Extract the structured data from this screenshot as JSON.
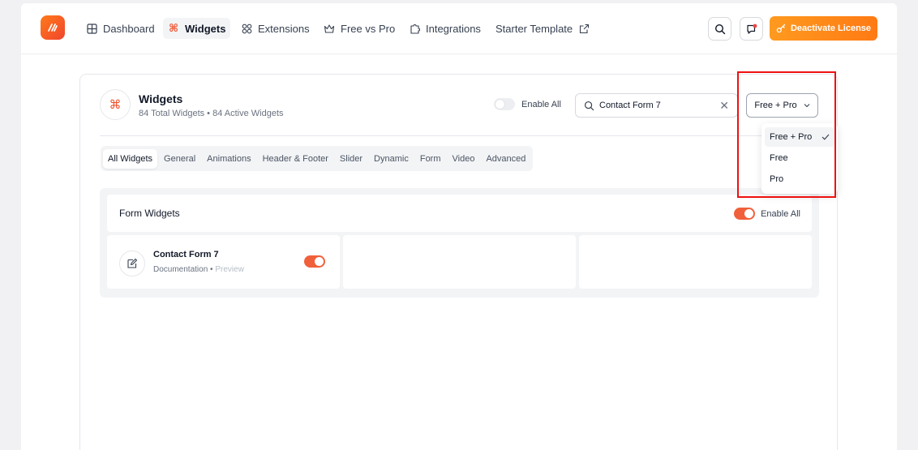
{
  "nav": {
    "items": [
      {
        "label": "Dashboard",
        "icon": "grid-icon"
      },
      {
        "label": "Widgets",
        "icon": "command-icon",
        "active": true
      },
      {
        "label": "Extensions",
        "icon": "extensions-icon"
      },
      {
        "label": "Free vs Pro",
        "icon": "crown-icon"
      },
      {
        "label": "Integrations",
        "icon": "puzzle-icon"
      },
      {
        "label": "Starter Template",
        "icon": "external-link-icon"
      }
    ],
    "license_label": "Deactivate License"
  },
  "widgets": {
    "title": "Widgets",
    "subtitle": "84 Total Widgets • 84 Active Widgets",
    "enable_all_label": "Enable All",
    "search_value": "Contact Form 7",
    "filter_selected": "Free + Pro",
    "tabs": [
      "All Widgets",
      "General",
      "Animations",
      "Header & Footer",
      "Slider",
      "Dynamic",
      "Form",
      "Video",
      "Advanced"
    ],
    "active_tab": "All Widgets"
  },
  "section": {
    "title": "Form Widgets",
    "enable_all_label": "Enable All",
    "enable_all_on": true,
    "card": {
      "name": "Contact Form 7",
      "doc_label": "Documentation",
      "separator": "•",
      "preview_label": "Preview",
      "enabled": true
    }
  },
  "dropdown": {
    "options": [
      "Free + Pro",
      "Free",
      "Pro"
    ],
    "selected": "Free + Pro"
  },
  "colors": {
    "accent": "#f0603a",
    "brand_gradient_start": "#ff7a1a",
    "highlight_box": "#ee1111"
  }
}
